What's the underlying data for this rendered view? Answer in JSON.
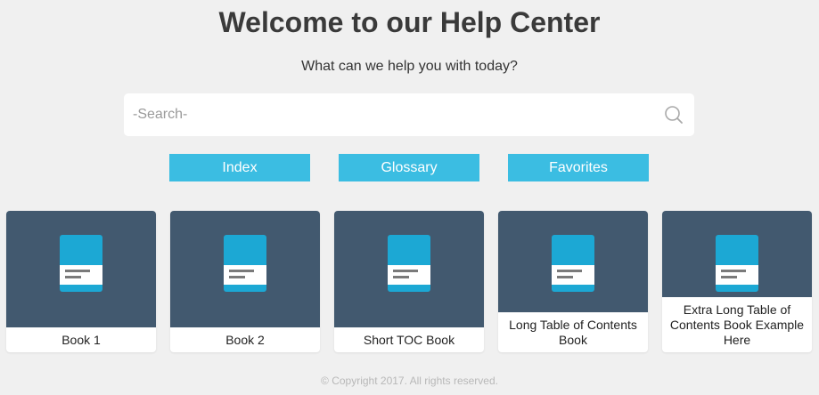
{
  "header": {
    "title": "Welcome to our Help Center",
    "subtitle": "What can we help you with today?"
  },
  "search": {
    "placeholder": "-Search-",
    "value": "",
    "icon": "search-icon"
  },
  "nav": {
    "index_label": "Index",
    "glossary_label": "Glossary",
    "favorites_label": "Favorites"
  },
  "books": [
    {
      "label": "Book 1",
      "icon": "book-icon"
    },
    {
      "label": "Book 2",
      "icon": "book-icon"
    },
    {
      "label": "Short TOC Book",
      "icon": "book-icon"
    },
    {
      "label": "Long Table of Contents Book",
      "icon": "book-icon"
    },
    {
      "label": "Extra Long Table of Contents Book Example Here",
      "icon": "book-icon"
    }
  ],
  "footer": {
    "copyright": "© Copyright 2017. All rights reserved."
  },
  "colors": {
    "background": "#f0f0f0",
    "accent": "#3bbde2",
    "card_header": "#42596f",
    "book_blue": "#1ca8d4"
  }
}
